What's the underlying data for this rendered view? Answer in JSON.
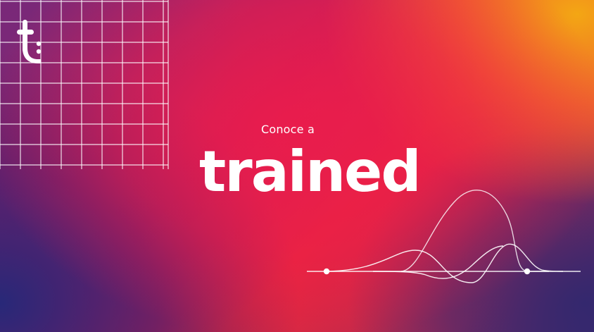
{
  "hero": {
    "intro": "Conoce a",
    "brand": "trained",
    "logo_icon": "trained-t-icon"
  },
  "decorations": {
    "grid_icon": "grid-pattern",
    "wave_icon": "wave-curves",
    "line_color": "#ffffff"
  },
  "palette": {
    "orange": "#f3a614",
    "red": "#e8283c",
    "magenta": "#c21e5a",
    "indigo": "#2a2a78"
  }
}
